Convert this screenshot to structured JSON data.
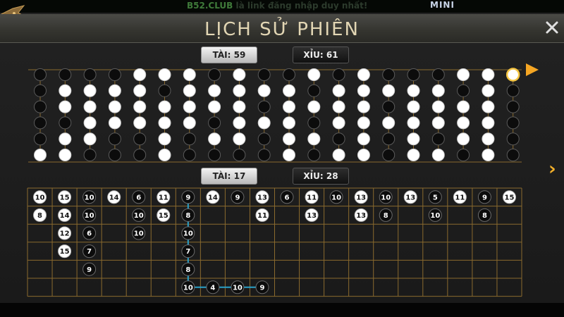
{
  "topbar": {
    "brand": "B52.CLUB",
    "message": " là link đăng nhập duy nhất!",
    "mini_logo": "MINI"
  },
  "header": {
    "title": "LỊCH SỬ PHIÊN"
  },
  "upper": {
    "tai_label": "TÀI:",
    "tai_value": "59",
    "xiu_label": "XỈU:",
    "xiu_value": "61"
  },
  "lower": {
    "tai_label": "TÀI:",
    "tai_value": "17",
    "xiu_label": "XỈU:",
    "xiu_value": "28"
  },
  "colors": {
    "accent": "#f5a623",
    "grid_line": "#8a6a2e",
    "white_dot": "#ffffff",
    "black_dot": "#0c0c0c",
    "connector": "#2aa0c8"
  },
  "dice_history": {
    "columns": [
      [
        "B",
        "B",
        "B",
        "B",
        "B",
        "W"
      ],
      [
        "B",
        "W",
        "W",
        "B",
        "W",
        "W"
      ],
      [
        "B",
        "W",
        "W",
        "W",
        "W",
        "B"
      ],
      [
        "B",
        "W",
        "W",
        "W",
        "B",
        "B"
      ],
      [
        "W",
        "W",
        "W",
        "W",
        "B",
        "B"
      ],
      [
        "W",
        "B",
        "W",
        "W",
        "W",
        "W"
      ],
      [
        "W",
        "W",
        "W",
        "W",
        "B",
        "B"
      ],
      [
        "B",
        "W",
        "W",
        "B",
        "W",
        "B"
      ],
      [
        "W",
        "W",
        "W",
        "W",
        "W",
        "B"
      ],
      [
        "B",
        "W",
        "B",
        "W",
        "B",
        "B"
      ],
      [
        "B",
        "W",
        "W",
        "W",
        "W",
        "W"
      ],
      [
        "W",
        "B",
        "W",
        "B",
        "W",
        "B"
      ],
      [
        "B",
        "W",
        "W",
        "W",
        "B",
        "W"
      ],
      [
        "W",
        "W",
        "W",
        "W",
        "W",
        "W"
      ],
      [
        "B",
        "W",
        "B",
        "W",
        "B",
        "B"
      ],
      [
        "B",
        "W",
        "W",
        "W",
        "W",
        "W"
      ],
      [
        "B",
        "W",
        "W",
        "W",
        "B",
        "W"
      ],
      [
        "W",
        "B",
        "W",
        "W",
        "W",
        "B"
      ],
      [
        "W",
        "W",
        "W",
        "W",
        "W",
        "W"
      ],
      [
        "W",
        "B",
        "B",
        "B",
        "B",
        "B"
      ]
    ]
  },
  "bead_road": {
    "col_count": 20,
    "row_count": 6,
    "cells": [
      {
        "c": 0,
        "r": 0,
        "v": "10",
        "t": "W"
      },
      {
        "c": 0,
        "r": 1,
        "v": "8",
        "t": "W"
      },
      {
        "c": 1,
        "r": 0,
        "v": "15",
        "t": "W"
      },
      {
        "c": 1,
        "r": 1,
        "v": "14",
        "t": "W"
      },
      {
        "c": 1,
        "r": 2,
        "v": "12",
        "t": "W"
      },
      {
        "c": 1,
        "r": 3,
        "v": "15",
        "t": "W"
      },
      {
        "c": 2,
        "r": 0,
        "v": "10",
        "t": "B"
      },
      {
        "c": 2,
        "r": 1,
        "v": "10",
        "t": "B"
      },
      {
        "c": 2,
        "r": 2,
        "v": "6",
        "t": "B"
      },
      {
        "c": 2,
        "r": 3,
        "v": "7",
        "t": "B"
      },
      {
        "c": 2,
        "r": 4,
        "v": "9",
        "t": "B"
      },
      {
        "c": 3,
        "r": 0,
        "v": "14",
        "t": "W"
      },
      {
        "c": 4,
        "r": 0,
        "v": "6",
        "t": "B"
      },
      {
        "c": 4,
        "r": 1,
        "v": "10",
        "t": "B"
      },
      {
        "c": 4,
        "r": 2,
        "v": "10",
        "t": "B"
      },
      {
        "c": 5,
        "r": 0,
        "v": "11",
        "t": "W"
      },
      {
        "c": 5,
        "r": 1,
        "v": "15",
        "t": "W"
      },
      {
        "c": 6,
        "r": 0,
        "v": "9",
        "t": "B"
      },
      {
        "c": 6,
        "r": 1,
        "v": "8",
        "t": "B"
      },
      {
        "c": 6,
        "r": 2,
        "v": "10",
        "t": "B"
      },
      {
        "c": 6,
        "r": 3,
        "v": "7",
        "t": "B"
      },
      {
        "c": 6,
        "r": 4,
        "v": "8",
        "t": "B"
      },
      {
        "c": 6,
        "r": 5,
        "v": "10",
        "t": "B"
      },
      {
        "c": 7,
        "r": 0,
        "v": "14",
        "t": "W"
      },
      {
        "c": 7,
        "r": 5,
        "v": "4",
        "t": "B"
      },
      {
        "c": 8,
        "r": 0,
        "v": "9",
        "t": "B"
      },
      {
        "c": 8,
        "r": 5,
        "v": "10",
        "t": "B"
      },
      {
        "c": 9,
        "r": 0,
        "v": "13",
        "t": "W"
      },
      {
        "c": 9,
        "r": 1,
        "v": "11",
        "t": "W"
      },
      {
        "c": 9,
        "r": 5,
        "v": "9",
        "t": "B"
      },
      {
        "c": 10,
        "r": 0,
        "v": "6",
        "t": "B"
      },
      {
        "c": 11,
        "r": 0,
        "v": "11",
        "t": "W"
      },
      {
        "c": 11,
        "r": 1,
        "v": "13",
        "t": "W"
      },
      {
        "c": 12,
        "r": 0,
        "v": "10",
        "t": "B"
      },
      {
        "c": 13,
        "r": 0,
        "v": "13",
        "t": "W"
      },
      {
        "c": 13,
        "r": 1,
        "v": "13",
        "t": "W"
      },
      {
        "c": 14,
        "r": 0,
        "v": "10",
        "t": "B"
      },
      {
        "c": 14,
        "r": 1,
        "v": "8",
        "t": "B"
      },
      {
        "c": 15,
        "r": 0,
        "v": "13",
        "t": "W"
      },
      {
        "c": 16,
        "r": 0,
        "v": "5",
        "t": "B"
      },
      {
        "c": 16,
        "r": 1,
        "v": "10",
        "t": "B"
      },
      {
        "c": 17,
        "r": 0,
        "v": "11",
        "t": "W"
      },
      {
        "c": 18,
        "r": 0,
        "v": "9",
        "t": "B"
      },
      {
        "c": 18,
        "r": 1,
        "v": "8",
        "t": "B"
      },
      {
        "c": 19,
        "r": 0,
        "v": "15",
        "t": "W"
      }
    ]
  }
}
